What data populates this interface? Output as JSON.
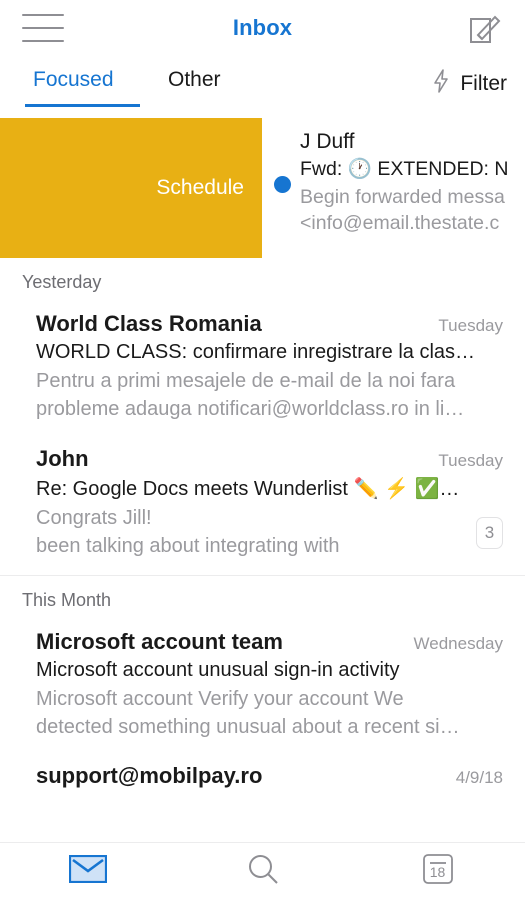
{
  "header": {
    "menu_icon": "hamburger-menu-icon",
    "title": "Inbox",
    "compose_icon": "compose-icon"
  },
  "tabs": {
    "focused_label": "Focused",
    "other_label": "Other",
    "selected": "Focused",
    "filter_label": "Filter",
    "filter_icon": "lightning-bolt-icon"
  },
  "swiped_row": {
    "action_label": "Schedule",
    "action_color": "#e8b014",
    "unread": true,
    "sender": "J Duff",
    "subject": "Fwd: 🕐  EXTENDED: N",
    "preview_line1": "Begin forwarded messa",
    "preview_line2": "<info@email.thestate.c"
  },
  "sections": [
    {
      "title": "Yesterday",
      "messages": [
        {
          "sender": "World Class Romania",
          "unread": true,
          "date": "Tuesday",
          "subject": "WORLD CLASS: confirmare inregistrare la clas…",
          "preview_line1": "Pentru a primi mesajele de e-mail de la noi fara",
          "preview_line2": "probleme adauga notificari@worldclass.ro in li…",
          "count": ""
        },
        {
          "sender": "John",
          "unread": true,
          "date": "Tuesday",
          "subject": "Re: Google Docs meets Wunderlist ✏️ ⚡ ✅…",
          "preview_line1": "Congrats Jill!",
          "preview_line2": "been talking about integrating with",
          "count": "3"
        }
      ]
    },
    {
      "title": "This Month",
      "messages": [
        {
          "sender": "Microsoft account team",
          "unread": true,
          "date": "Wednesday",
          "subject": "Microsoft account unusual sign-in activity",
          "preview_line1": "Microsoft account Verify your account We",
          "preview_line2": "detected something unusual about a recent si…",
          "count": ""
        },
        {
          "sender": "support@mobilpay.ro",
          "unread": true,
          "date": "4/9/18",
          "subject": "",
          "preview_line1": "",
          "preview_line2": "",
          "count": ""
        }
      ]
    }
  ],
  "bottom_nav": {
    "items": [
      {
        "icon": "mail-icon",
        "selected": true
      },
      {
        "icon": "search-icon",
        "selected": false
      },
      {
        "icon": "calendar-icon",
        "selected": false
      }
    ],
    "calendar_day": "18"
  },
  "colors": {
    "accent_blue": "#1675d1",
    "schedule_yellow": "#e8b014",
    "muted_gray": "#9a9a9e"
  }
}
